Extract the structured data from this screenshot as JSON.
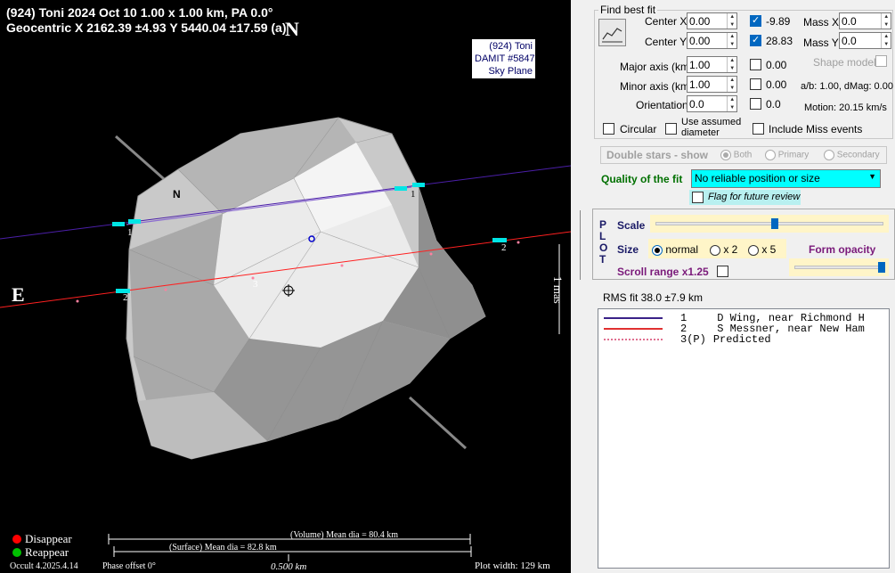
{
  "plot": {
    "header_line1": "(924) Toni  2024 Oct 10  1.00 x 1.00 km, PA 0.0°",
    "header_line2": "Geocentric  X  2162.39 ±4.93  Y 5440.04 ±17.59 (a)",
    "north_big": "N",
    "east_big": "E",
    "north_small": "N",
    "legend": [
      "(924) Toni",
      "DAMIT #5847",
      "Sky Plane"
    ],
    "mas_label": "1 mas",
    "disappear": "Disappear",
    "reappear": "Reappear",
    "volume_dia": "(Volume) Mean dia = 80.4 km",
    "surface_dia": "(Surface) Mean dia = 82.8 km",
    "version": "Occult 4.2025.4.14",
    "phase_offset": "Phase offset 0°",
    "scale_km": "0.500 km",
    "plot_width": "Plot width: 129 km",
    "chord_labels": [
      "1",
      "1",
      "2",
      "2",
      "3"
    ],
    "colors": {
      "chord1": "#4b1fa8",
      "chord2": "#ff2020",
      "marker": "#00e5e5",
      "disappear": "#ff0000",
      "reappear": "#00c000"
    }
  },
  "panel": {
    "find_best_fit": "Find best fit",
    "center_x_label": "Center X",
    "center_x_value": "0.00",
    "center_y_label": "Center Y",
    "center_y_value": "0.00",
    "cx_result": "-9.89",
    "cy_result": "28.83",
    "mass_x_label": "Mass X",
    "mass_x_value": "0.0",
    "mass_y_label": "Mass Y",
    "mass_y_value": "0.0",
    "shape_model": "Shape model",
    "major_label": "Major axis (km)",
    "major_value": "1.00",
    "major_result": "0.00",
    "minor_label": "Minor axis (km)",
    "minor_value": "1.00",
    "minor_result": "0.00",
    "orient_label": "Orientation",
    "orient_value": "0.0",
    "orient_result": "0.0",
    "ab_text": "a/b: 1.00, dMag: 0.00",
    "motion_text": "Motion: 20.15 km/s",
    "circular": "Circular",
    "use_assumed": "Use assumed diameter",
    "include_miss": "Include Miss events",
    "double_stars": "Double stars - show",
    "both": "Both",
    "primary": "Primary",
    "secondary": "Secondary",
    "quality_label": "Quality of the fit",
    "quality_value": "No reliable position or size",
    "flag_review": "Flag for future review",
    "plot_letters": [
      "P",
      "L",
      "O",
      "T"
    ],
    "scale_label": "Scale",
    "size_label": "Size",
    "size_normal": "normal",
    "size_x2": "x 2",
    "size_x5": "x 5",
    "form_opacity": "Form opacity",
    "scroll_range": "Scroll range x1.25",
    "rms_fit": "RMS fit 38.0 ±7.9 km",
    "chords": [
      {
        "num": "1",
        "name": "D Wing, near Richmond H",
        "color": "#3a2288",
        "style": "solid"
      },
      {
        "num": "2",
        "name": "S Messner, near New Ham",
        "color": "#e03030",
        "style": "solid"
      },
      {
        "num": "3(P)",
        "name": "Predicted",
        "color": "#e07090",
        "style": "dotted"
      }
    ]
  }
}
